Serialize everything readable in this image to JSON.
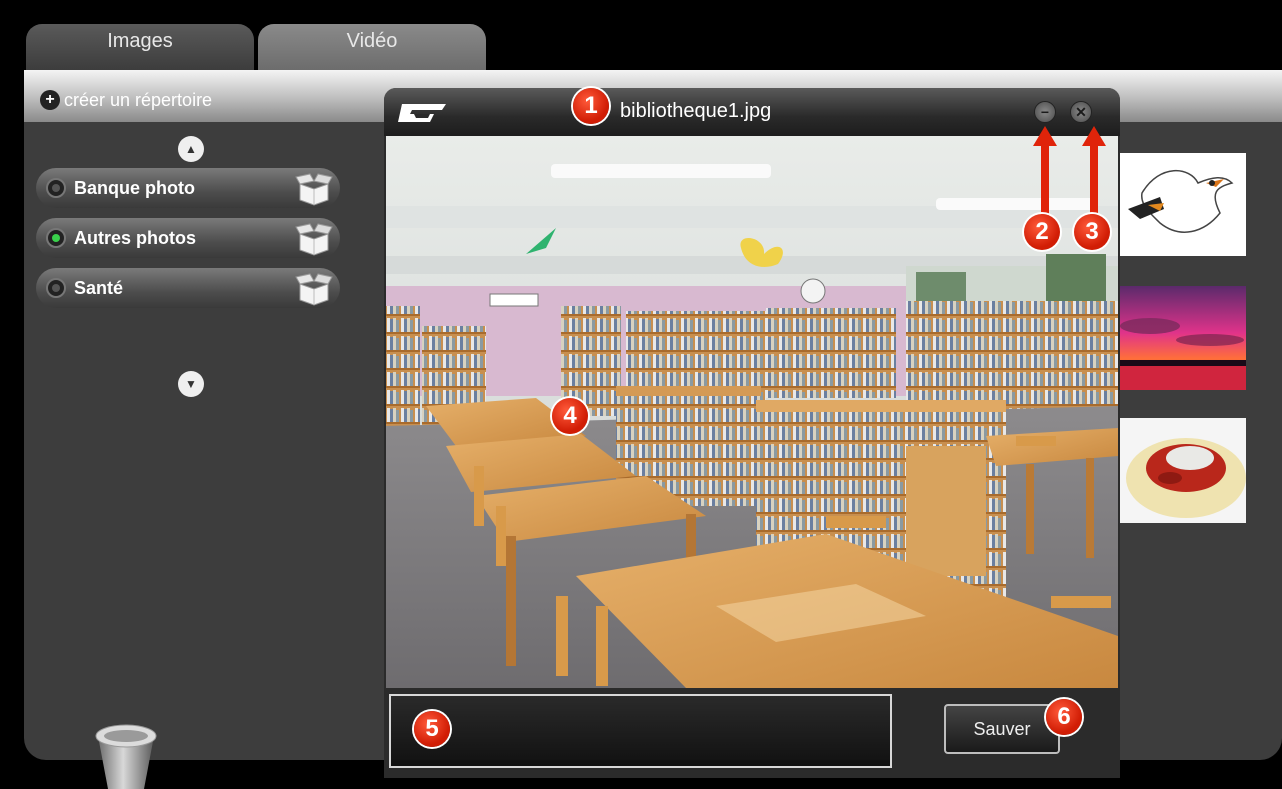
{
  "tabs": [
    {
      "label": "Images"
    },
    {
      "label": "Vidéo"
    }
  ],
  "sidebar": {
    "create_directory_label": "créer un répertoire",
    "folders": [
      {
        "label": "Banque photo",
        "active": false
      },
      {
        "label": "Autres photos",
        "active": true
      },
      {
        "label": "Santé",
        "active": false
      }
    ]
  },
  "dialog": {
    "title": "bibliotheque1.jpg",
    "save_label": "Sauver",
    "caption_value": ""
  },
  "thumbnails": [
    {
      "subject": "seagull drawing"
    },
    {
      "subject": "sunset"
    },
    {
      "subject": "spaghetti"
    }
  ],
  "markers": [
    "1",
    "2",
    "3",
    "4",
    "5",
    "6"
  ],
  "colors": {
    "marker_red": "#e0240a",
    "panel_bg": "#3d3d3d",
    "active_dot": "#39d14b"
  }
}
